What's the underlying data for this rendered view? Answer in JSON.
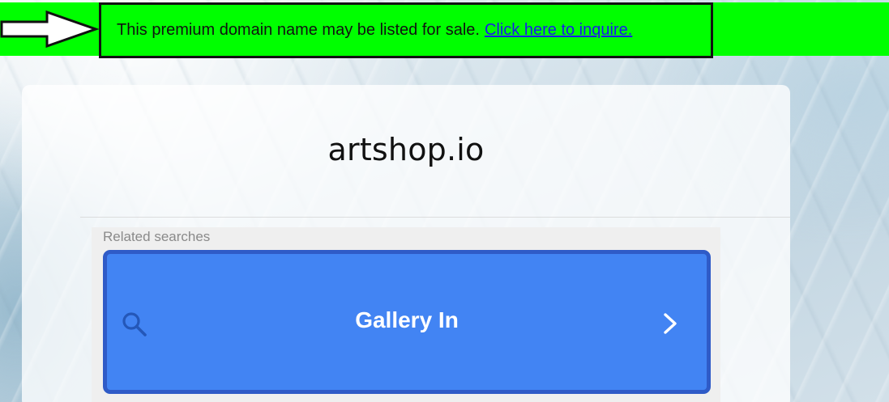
{
  "banner": {
    "message": "This premium domain name may be listed for sale.",
    "link_label": "Click here to inquire."
  },
  "card": {
    "domain": "artshop.io"
  },
  "related": {
    "label": "Related searches",
    "items": [
      {
        "label": "Gallery In",
        "icon": "search-icon",
        "action_icon": "chevron-right-icon"
      }
    ]
  },
  "colors": {
    "banner_bg": "#00ff00",
    "button_bg": "#4284f3",
    "button_border": "#2f5bc7",
    "link": "#1a1aee"
  }
}
